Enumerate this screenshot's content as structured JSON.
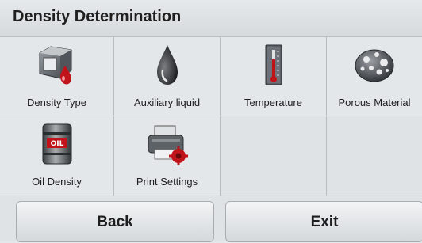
{
  "header": {
    "title": "Density Determination"
  },
  "tiles": [
    {
      "label": "Density Type",
      "icon": "density-type-icon"
    },
    {
      "label": "Auxiliary liquid",
      "icon": "liquid-drop-icon"
    },
    {
      "label": "Temperature",
      "icon": "thermometer-icon"
    },
    {
      "label": "Porous Material",
      "icon": "porous-rock-icon"
    },
    {
      "label": "Oil Density",
      "icon": "oil-barrel-icon"
    },
    {
      "label": "Print Settings",
      "icon": "printer-settings-icon"
    }
  ],
  "buttons": {
    "back": "Back",
    "exit": "Exit"
  }
}
